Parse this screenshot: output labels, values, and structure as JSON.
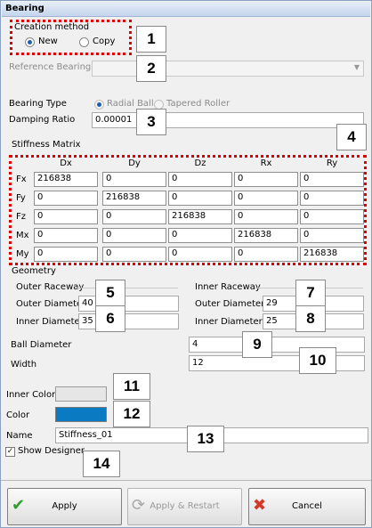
{
  "window": {
    "title": "Bearing"
  },
  "creation": {
    "label": "Creation method",
    "options": [
      {
        "label": "New",
        "selected": true
      },
      {
        "label": "Copy",
        "selected": false
      }
    ]
  },
  "reference_bearing": {
    "label": "Reference Bearing",
    "value": ""
  },
  "bearing_type": {
    "label": "Bearing Type",
    "options": [
      {
        "label": "Radial Ball",
        "selected": true
      },
      {
        "label": "Tapered Roller",
        "selected": false
      }
    ]
  },
  "damping_ratio": {
    "label": "Damping Ratio",
    "value": "0.00001"
  },
  "stiffness": {
    "label": "Stiffness Matrix",
    "columns": [
      "Dx",
      "Dy",
      "Dz",
      "Rx",
      "Ry"
    ],
    "rows": [
      {
        "label": "Fx",
        "values": [
          "216838",
          "0",
          "0",
          "0",
          "0"
        ]
      },
      {
        "label": "Fy",
        "values": [
          "0",
          "216838",
          "0",
          "0",
          "0"
        ]
      },
      {
        "label": "Fz",
        "values": [
          "0",
          "0",
          "216838",
          "0",
          "0"
        ]
      },
      {
        "label": "Mx",
        "values": [
          "0",
          "0",
          "0",
          "216838",
          "0"
        ]
      },
      {
        "label": "My",
        "values": [
          "0",
          "0",
          "0",
          "0",
          "216838"
        ]
      }
    ]
  },
  "geometry": {
    "label": "Geometry",
    "outer_raceway": {
      "label": "Outer Raceway",
      "outer_diameter_label": "Outer Diameter",
      "outer_diameter": "40",
      "inner_diameter_label": "Inner Diameter",
      "inner_diameter": "35"
    },
    "inner_raceway": {
      "label": "Inner Raceway",
      "outer_diameter_label": "Outer Diameter",
      "outer_diameter": "29",
      "inner_diameter_label": "Inner Diameter",
      "inner_diameter": "25"
    },
    "ball_diameter_label": "Ball Diameter",
    "ball_diameter": "4",
    "width_label": "Width",
    "width": "12"
  },
  "inner_color": {
    "label": "Inner Color",
    "color": "#e6e6e6"
  },
  "color": {
    "label": "Color",
    "color": "#0a7bc3"
  },
  "name": {
    "label": "Name",
    "value": "Stiffness_01"
  },
  "show_designer": {
    "label": "Show Designer",
    "checked": true
  },
  "buttons": {
    "apply": "Apply",
    "apply_restart": "Apply & Restart",
    "cancel": "Cancel"
  },
  "callouts": [
    "1",
    "2",
    "3",
    "4",
    "5",
    "6",
    "7",
    "8",
    "9",
    "10",
    "11",
    "12",
    "13",
    "14"
  ]
}
